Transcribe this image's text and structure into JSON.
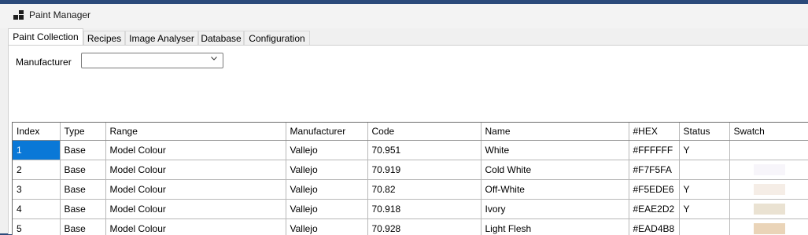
{
  "window": {
    "title": "Paint Manager"
  },
  "tabs": [
    {
      "label": "Paint Collection",
      "active": true
    },
    {
      "label": "Recipes"
    },
    {
      "label": "Image Analyser"
    },
    {
      "label": "Database"
    },
    {
      "label": "Configuration"
    }
  ],
  "filter": {
    "label": "Manufacturer",
    "value": ""
  },
  "table": {
    "columns": [
      "Index",
      "Type",
      "Range",
      "Manufacturer",
      "Code",
      "Name",
      "#HEX",
      "Status",
      "Swatch"
    ],
    "selected": {
      "row": 0,
      "col": 0
    },
    "rows": [
      {
        "index": "1",
        "type": "Base",
        "range": "Model Colour",
        "manufacturer": "Vallejo",
        "code": "70.951",
        "name": "White",
        "hex": "#FFFFFF",
        "status": "Y",
        "swatch": "#FFFFFF"
      },
      {
        "index": "2",
        "type": "Base",
        "range": "Model Colour",
        "manufacturer": "Vallejo",
        "code": "70.919",
        "name": "Cold White",
        "hex": "#F7F5FA",
        "status": "",
        "swatch": "#F7F5FA"
      },
      {
        "index": "3",
        "type": "Base",
        "range": "Model Colour",
        "manufacturer": "Vallejo",
        "code": "70.82",
        "name": "Off-White",
        "hex": "#F5EDE6",
        "status": "Y",
        "swatch": "#F5EDE6"
      },
      {
        "index": "4",
        "type": "Base",
        "range": "Model Colour",
        "manufacturer": "Vallejo",
        "code": "70.918",
        "name": "Ivory",
        "hex": "#EAE2D2",
        "status": "Y",
        "swatch": "#EAE2D2"
      },
      {
        "index": "5",
        "type": "Base",
        "range": "Model Colour",
        "manufacturer": "Vallejo",
        "code": "70.928",
        "name": "Light Flesh",
        "hex": "#EAD4B8",
        "status": "",
        "swatch": "#EAD4B8"
      }
    ]
  },
  "icons": {
    "app": "app-window-icon",
    "dropdown": "chevron-down-icon"
  },
  "colors": {
    "selection": "#0A78D7",
    "desktop": "#2B4A7A"
  }
}
